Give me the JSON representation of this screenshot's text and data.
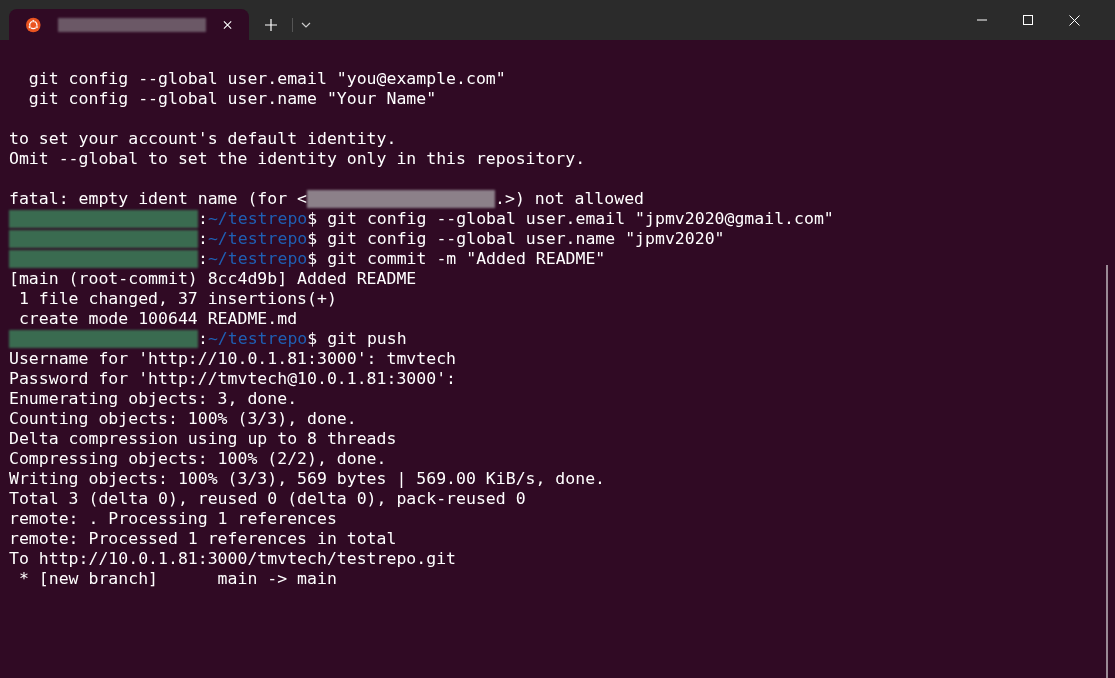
{
  "tab": {
    "selected": true
  },
  "lines": [
    {
      "kind": "blank"
    },
    {
      "kind": "text",
      "text": "  git config --global user.email \"you@example.com\""
    },
    {
      "kind": "text",
      "text": "  git config --global user.name \"Your Name\""
    },
    {
      "kind": "blank"
    },
    {
      "kind": "text",
      "text": "to set your account's default identity."
    },
    {
      "kind": "text",
      "text": "Omit --global to set the identity only in this repository."
    },
    {
      "kind": "blank"
    },
    {
      "kind": "redacted",
      "before": "fatal: empty ident name (for <",
      "after": ".>) not allowed"
    },
    {
      "kind": "prompt",
      "separator": ":",
      "path": "~/testrepo",
      "command": "$ git config --global user.email \"jpmv2020@gmail.com\""
    },
    {
      "kind": "prompt",
      "separator": ":",
      "path": "~/testrepo",
      "command": "$ git config --global user.name \"jpmv2020\""
    },
    {
      "kind": "prompt",
      "separator": ":",
      "path": "~/testrepo",
      "command": "$ git commit -m \"Added README\""
    },
    {
      "kind": "text",
      "text": "[main (root-commit) 8cc4d9b] Added README"
    },
    {
      "kind": "text",
      "text": " 1 file changed, 37 insertions(+)"
    },
    {
      "kind": "text",
      "text": " create mode 100644 README.md"
    },
    {
      "kind": "prompt",
      "separator": ":",
      "path": "~/testrepo",
      "command": "$ git push"
    },
    {
      "kind": "text",
      "text": "Username for 'http://10.0.1.81:3000': tmvtech"
    },
    {
      "kind": "text",
      "text": "Password for 'http://tmvtech@10.0.1.81:3000':"
    },
    {
      "kind": "text",
      "text": "Enumerating objects: 3, done."
    },
    {
      "kind": "text",
      "text": "Counting objects: 100% (3/3), done."
    },
    {
      "kind": "text",
      "text": "Delta compression using up to 8 threads"
    },
    {
      "kind": "text",
      "text": "Compressing objects: 100% (2/2), done."
    },
    {
      "kind": "text",
      "text": "Writing objects: 100% (3/3), 569 bytes | 569.00 KiB/s, done."
    },
    {
      "kind": "text",
      "text": "Total 3 (delta 0), reused 0 (delta 0), pack-reused 0"
    },
    {
      "kind": "text",
      "text": "remote: . Processing 1 references"
    },
    {
      "kind": "text",
      "text": "remote: Processed 1 references in total"
    },
    {
      "kind": "text",
      "text": "To http://10.0.1.81:3000/tmvtech/testrepo.git"
    },
    {
      "kind": "text",
      "text": " * [new branch]      main -> main"
    }
  ]
}
